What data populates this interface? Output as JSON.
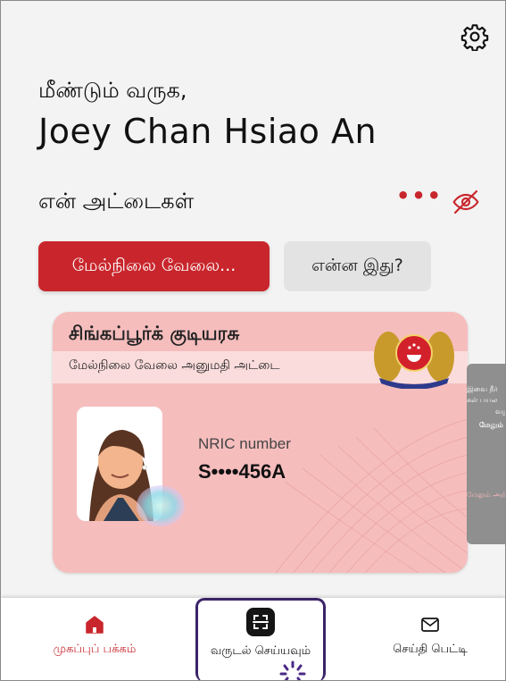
{
  "header": {
    "welcome": "மீண்டும் வருக,",
    "user_name": "Joey Chan Hsiao An",
    "settings_icon": "gear-icon"
  },
  "cards_section": {
    "title": "என் அட்டைகள்",
    "more_label": "•••",
    "hide_icon": "eye-off-icon"
  },
  "buttons": {
    "primary_label": "மேல்நிலை வேலை...",
    "secondary_label": "என்ன இது?"
  },
  "card": {
    "header": "சிங்கப்பூர்க் குடியரசு",
    "subtitle": "மேல்நிலை வேலை அனுமதி அட்டை",
    "nric_label": "NRIC number",
    "nric_value": "S••••456A",
    "crest_icon": "singapore-crest-icon",
    "background_color": "#f6bdbd"
  },
  "next_card_peek": {
    "line1": "இவை நீர்",
    "line2": "கள் பயல",
    "line3": "வழ",
    "line4": "மேலும்",
    "line5": "மேலும் அறி"
  },
  "tabbar": {
    "home_label": "முகப்புப் பக்கம்",
    "scan_label": "வருடல் செய்யவும்",
    "inbox_label": "செய்தி பெட்டி",
    "active_color": "#c8262c"
  }
}
